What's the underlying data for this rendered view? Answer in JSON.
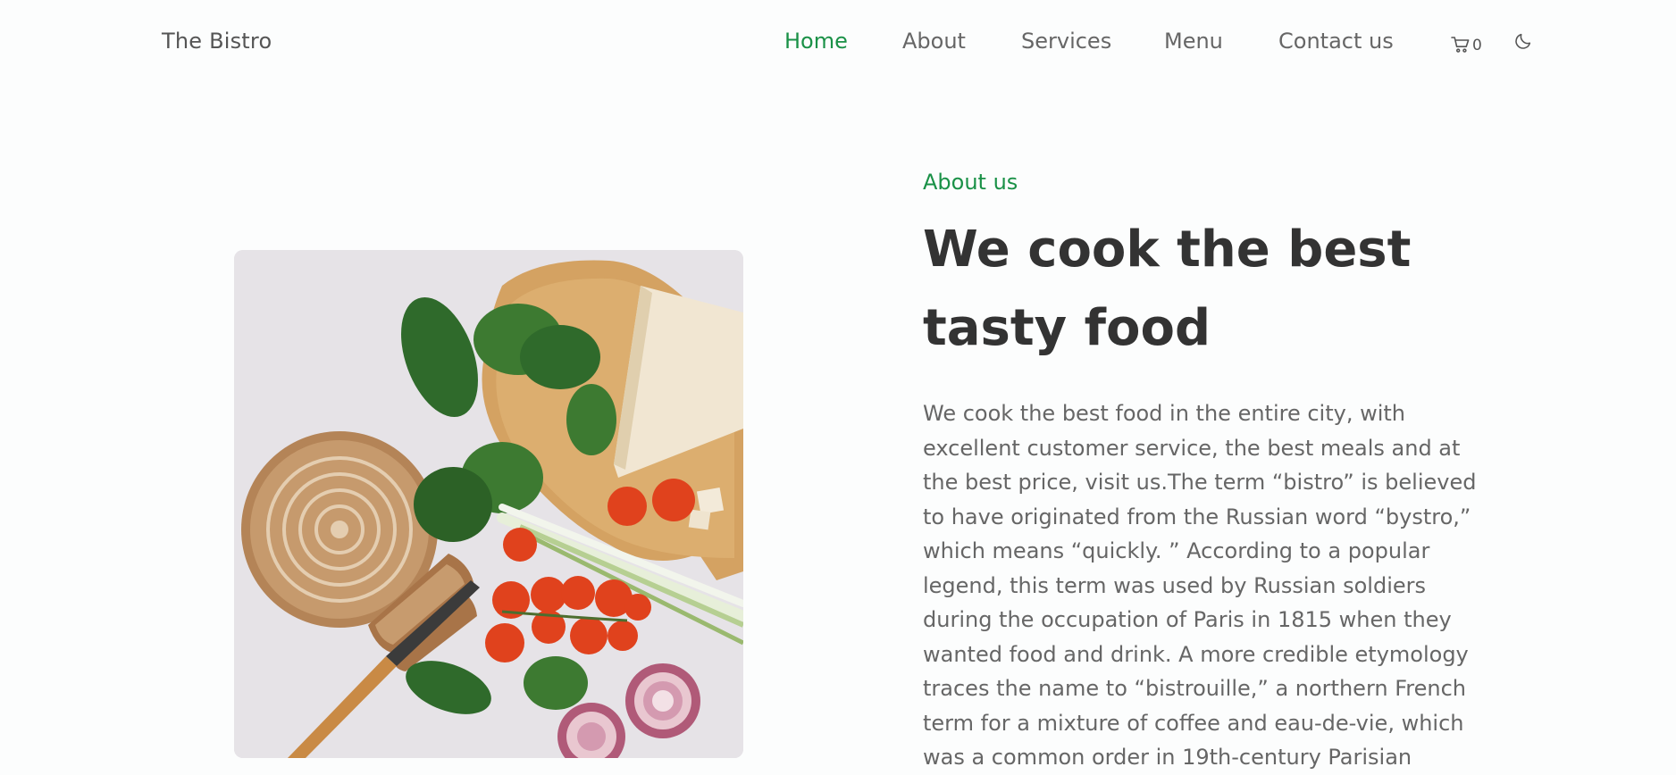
{
  "header": {
    "logo": "The Bistro",
    "nav": [
      "Home",
      "About",
      "Services",
      "Menu",
      "Contact us"
    ],
    "active_nav": "Home",
    "cart_count": "0",
    "icons": {
      "cart": "shopping-cart-icon",
      "theme": "moon-icon"
    }
  },
  "about": {
    "subtitle": "About us",
    "title": "We cook the best tasty food",
    "description": "We cook the best food in the entire city, with excellent customer service, the best meals and at the best price, visit us.The term “bistro” is believed to have originated from the Russian word “bystro,” which means “quickly. ” According to a popular legend, this term was used by Russian soldiers during the occupation of Paris in 1815 when they wanted food and drink. A more credible etymology traces the name to “bistrouille,” a northern French term for a mixture of coffee and eau-de-vie, which was a common order in 19th-century Parisian"
  },
  "colors": {
    "accent": "#1a9147",
    "background": "#fcfdfd",
    "heading": "#333333",
    "text": "#666666"
  }
}
